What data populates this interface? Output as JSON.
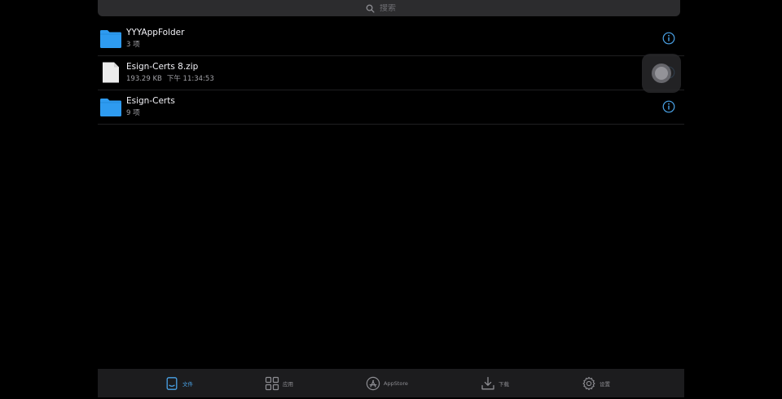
{
  "search": {
    "placeholder": "搜索"
  },
  "files": [
    {
      "name": "YYYAppFolder",
      "type": "folder",
      "meta": "3 项",
      "time": ""
    },
    {
      "name": "Esign-Certs 8.zip",
      "type": "zip",
      "meta": "193.29 KB",
      "time": "下午 11:34:53"
    },
    {
      "name": "Esign-Certs",
      "type": "folder",
      "meta": "9 项",
      "time": ""
    }
  ],
  "tabs": [
    {
      "label": "文件",
      "icon": "file-tab-icon",
      "active": true
    },
    {
      "label": "应用",
      "icon": "apps-grid-icon",
      "active": false
    },
    {
      "label": "AppStore",
      "icon": "appstore-icon",
      "active": false
    },
    {
      "label": "下载",
      "icon": "download-icon",
      "active": false
    },
    {
      "label": "设置",
      "icon": "gear-icon",
      "active": false
    }
  ],
  "colors": {
    "accent": "#4aa3e8",
    "folder": "#2e9bf0",
    "background": "#000000",
    "tab_bar": "#1c1c1e"
  }
}
